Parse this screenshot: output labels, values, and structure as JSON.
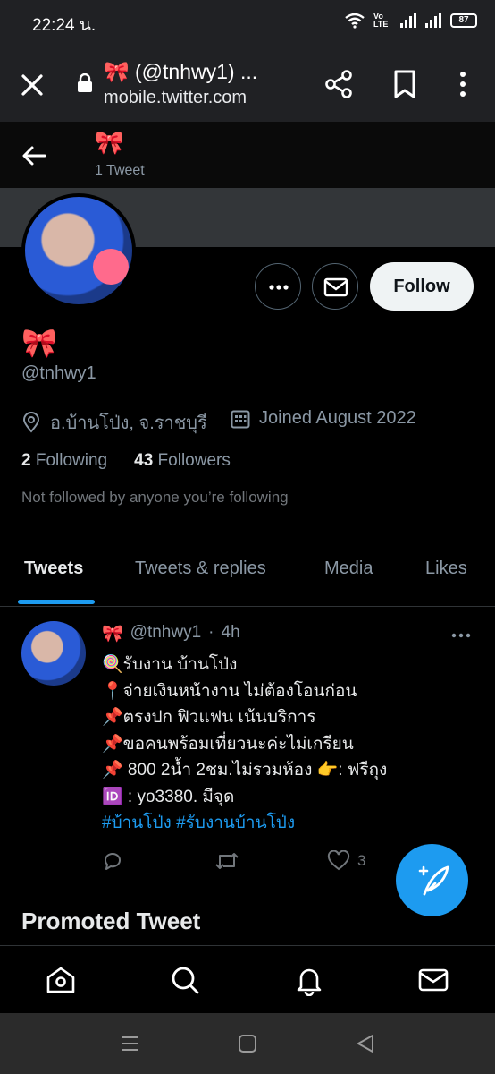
{
  "status_bar": {
    "time": "22:24 น.",
    "network_label": "Vo LTE",
    "battery": "87"
  },
  "browser": {
    "title": "🎀 (@tnhwy1) ...",
    "url": "mobile.twitter.com"
  },
  "header": {
    "name": "🎀",
    "tweet_count": "1 Tweet"
  },
  "profile": {
    "display_name": "🎀",
    "handle": "@tnhwy1",
    "location": "อ.บ้านโป่ง, จ.ราชบุรี",
    "joined": "Joined August 2022",
    "following_count": "2",
    "following_label": "Following",
    "followers_count": "43",
    "followers_label": "Followers",
    "not_followed_note": "Not followed by anyone you’re following",
    "follow_label": "Follow"
  },
  "tabs": [
    {
      "label": "Tweets",
      "active": true
    },
    {
      "label": "Tweets & replies",
      "active": false
    },
    {
      "label": "Media",
      "active": false
    },
    {
      "label": "Likes",
      "active": false
    }
  ],
  "tweet": {
    "name": "🎀",
    "handle": "@tnhwy1",
    "separator": "·",
    "time": "4h",
    "lines": [
      "🍭รับงาน บ้านโป่ง",
      "📍จ่ายเงินหน้างาน ไม่ต้องโอนก่อน",
      "📌ตรงปก ฟิวแฟน เน้นบริการ",
      "📌ขอคนพร้อมเที่ยวนะค่ะไม่เกรียน",
      "📌 800 2น้ำ 2ชม.ไม่รวมห้อง 👉: ฟรีถุง",
      "🆔 : yo3380. มีจุด"
    ],
    "hashtags": "#บ้านโป่ง #รับงานบ้านโป่ง",
    "like_count": "3"
  },
  "promoted_label": "Promoted Tweet",
  "colors": {
    "accent": "#1d9bf0",
    "background": "#000000",
    "muted_text": "#8b98a5"
  }
}
